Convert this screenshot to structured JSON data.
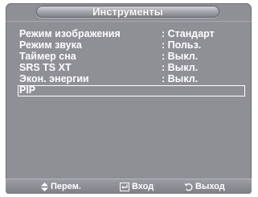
{
  "title": "Инструменты",
  "menu": {
    "items": [
      {
        "label": "Режим изображения",
        "value": ": Стандарт"
      },
      {
        "label": "Режим звука",
        "value": ": Польз."
      },
      {
        "label": "Таймер сна",
        "value": ": Выкл."
      },
      {
        "label": "SRS TS XT",
        "value": ": Выкл."
      },
      {
        "label": "Экон. энергии",
        "value": ": Выкл."
      },
      {
        "label": "PIP",
        "value": ""
      }
    ],
    "selected_index": 5
  },
  "footer": {
    "move_label": "Перем.",
    "move_icon": "up-down-arrows-icon",
    "enter_label": "Вход",
    "enter_icon": "enter-icon",
    "exit_label": "Выход",
    "exit_icon": "return-icon"
  },
  "colors": {
    "background": "#8f8f96",
    "text": "#ffffff"
  }
}
